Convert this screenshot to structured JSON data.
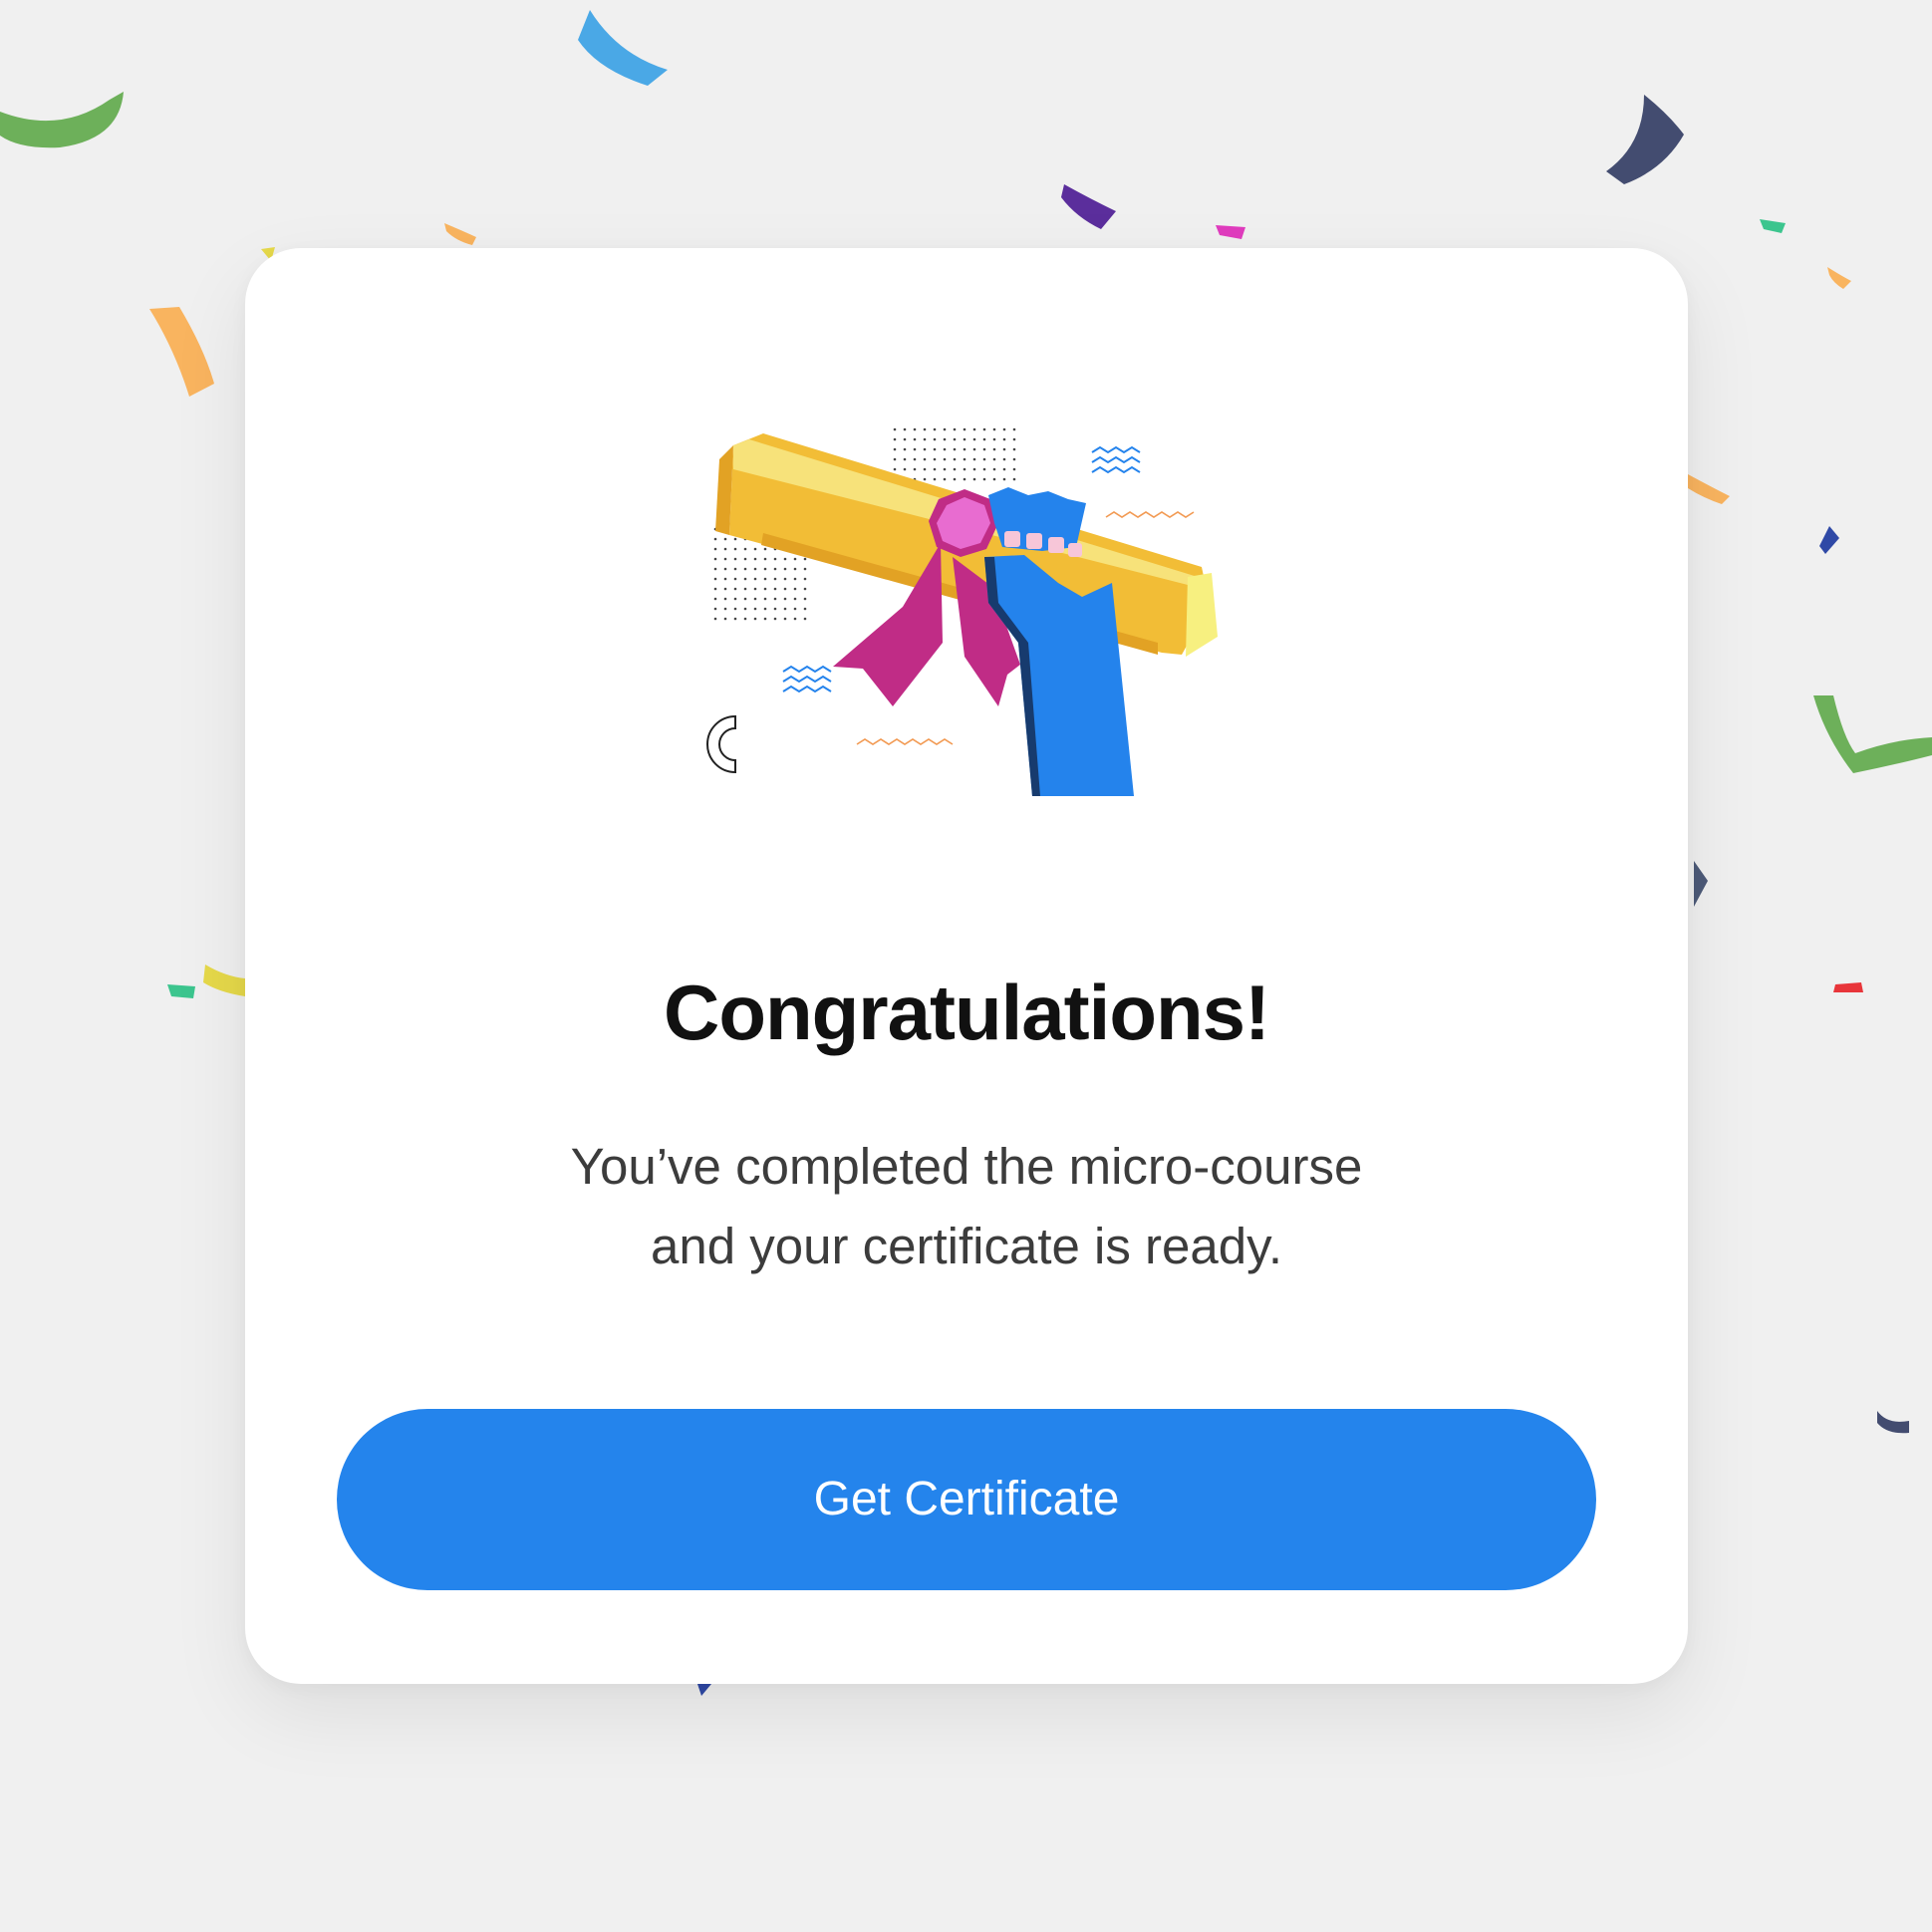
{
  "dialog": {
    "title": "Congratulations!",
    "message_line1": "You’ve completed the micro-course",
    "message_line2": "and your certificate is ready.",
    "button_label": "Get Certificate"
  },
  "colors": {
    "background": "#f0f0f0",
    "card": "#ffffff",
    "accent": "#2484ec",
    "scroll_gold": "#f2bd36",
    "ribbon_magenta": "#c02c86",
    "hand_blue": "#2483ec"
  },
  "icons": [
    "confetti",
    "diploma-in-hand-illustration"
  ]
}
